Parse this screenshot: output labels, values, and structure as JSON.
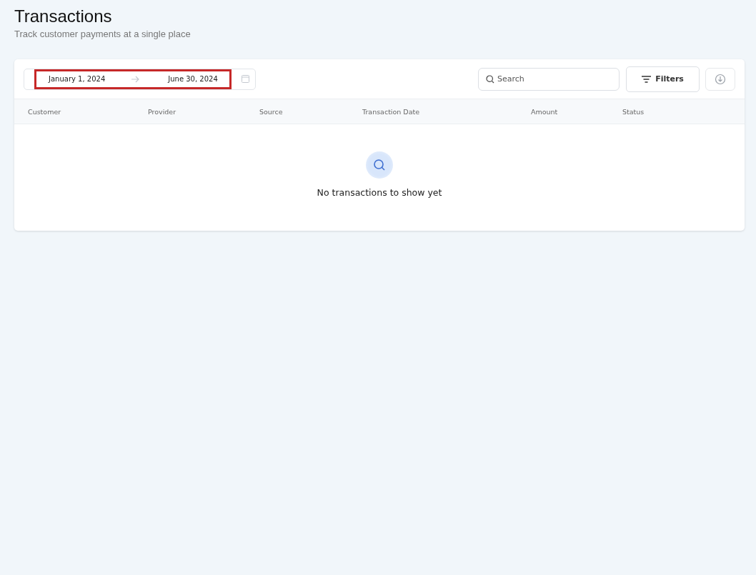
{
  "header": {
    "title": "Transactions",
    "subtitle": "Track customer payments at a single place"
  },
  "date_range": {
    "start": "January 1, 2024",
    "end": "June 30, 2024",
    "highlighted": true
  },
  "search": {
    "placeholder": "Search"
  },
  "filters_button": {
    "label": "Filters"
  },
  "table": {
    "columns": [
      "Customer",
      "Provider",
      "Source",
      "Transaction Date",
      "Amount",
      "Status"
    ]
  },
  "empty_state": {
    "message": "No transactions to show yet"
  }
}
